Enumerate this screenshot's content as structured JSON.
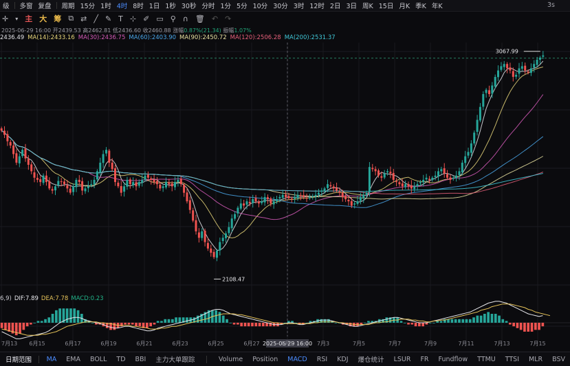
{
  "topbar": {
    "items": [
      "级",
      "多窗",
      "复盘",
      "周期",
      "15分",
      "1时",
      "4时",
      "8时",
      "1日",
      "1秒",
      "30秒",
      "分时",
      "1分",
      "5分",
      "10分",
      "30分",
      "3时",
      "12时",
      "2日",
      "3日",
      "周K",
      "15日",
      "月K",
      "季K",
      "年K"
    ],
    "active_index": 6,
    "right": "3s",
    "icons": [
      "grid-icon",
      "eye-icon",
      "chevron-down-icon"
    ]
  },
  "toolbar": {
    "crosshair": "✛",
    "zhu": "主",
    "da": "大",
    "chou": "筹",
    "tools": [
      "indicator-icon",
      "compare-icon",
      "line-icon",
      "draw-icon",
      "text-icon",
      "measure-icon",
      "brush-icon",
      "ruler-icon",
      "filter-icon",
      "magnet-icon",
      "delete-icon",
      "undo-icon",
      "redo-icon"
    ]
  },
  "info": {
    "date": "2025-06-29 16:00",
    "open_label": "开",
    "open": "2439.53",
    "high_label": "高",
    "high": "2462.81",
    "low_label": "低",
    "low": "2436.60",
    "close_label": "收",
    "close": "2460.88",
    "chg_label": "涨幅",
    "chg": "0.87%(21.34)",
    "amp_label": "振幅",
    "amp": "1.07%"
  },
  "ma_legend": [
    {
      "text": "2436.49",
      "color": "#e6e6ea"
    },
    {
      "text": "MA(14):2433.16",
      "color": "#e8d67a"
    },
    {
      "text": "MA(30):2436.75",
      "color": "#d55ab8"
    },
    {
      "text": "MA(60):2403.90",
      "color": "#4aa6e8"
    },
    {
      "text": "MA(90):2450.72",
      "color": "#e7e0a0"
    },
    {
      "text": "MA(120):2506.28",
      "color": "#e6607a"
    },
    {
      "text": "MA(200):2531.37",
      "color": "#40c8d8"
    }
  ],
  "macd_legend": [
    {
      "text": "6,9)",
      "color": "#c9c9cf"
    },
    {
      "text": "DIF:7.89",
      "color": "#e8e8ec"
    },
    {
      "text": "DEA:7.78",
      "color": "#e8c55a"
    },
    {
      "text": "MACD:0.23",
      "color": "#22b58a"
    }
  ],
  "chart_data": {
    "type": "candlestick",
    "symbol_price_unit": "USD",
    "ylim": [
      1990,
      3120
    ],
    "high_marker": "3067.99",
    "low_marker": "2108.47",
    "crosshair_label": "2025-06-29 16:00",
    "x_tick_labels": [
      "7月13",
      "6月15",
      "6月17",
      "6月19",
      "6月21",
      "6月23",
      "6月25",
      "6月27",
      "7月1",
      "7月3",
      "7月5",
      "7月7",
      "7月9",
      "7月11",
      "7月13",
      "7月15"
    ],
    "close": [
      2710,
      2690,
      2660,
      2640,
      2600,
      2560,
      2590,
      2620,
      2580,
      2550,
      2520,
      2490,
      2480,
      2470,
      2500,
      2470,
      2440,
      2430,
      2450,
      2475,
      2470,
      2460,
      2440,
      2420,
      2450,
      2480,
      2470,
      2430,
      2440,
      2450,
      2460,
      2480,
      2520,
      2560,
      2600,
      2620,
      2560,
      2530,
      2470,
      2450,
      2420,
      2450,
      2480,
      2460,
      2470,
      2450,
      2470,
      2480,
      2500,
      2490,
      2480,
      2470,
      2460,
      2440,
      2450,
      2470,
      2460,
      2450,
      2470,
      2480,
      2460,
      2420,
      2380,
      2340,
      2290,
      2240,
      2210,
      2240,
      2190,
      2160,
      2140,
      2120,
      2150,
      2190,
      2210,
      2230,
      2260,
      2300,
      2320,
      2350,
      2370,
      2360,
      2380,
      2370,
      2390,
      2380,
      2370,
      2380,
      2400,
      2390,
      2370,
      2380,
      2390,
      2400,
      2410,
      2400,
      2395,
      2390,
      2400,
      2410,
      2405,
      2400,
      2395,
      2400,
      2405,
      2410,
      2420,
      2430,
      2440,
      2460,
      2450,
      2440,
      2430,
      2420,
      2400,
      2390,
      2380,
      2360,
      2370,
      2380,
      2400,
      2410,
      2420,
      2540,
      2530,
      2520,
      2500,
      2490,
      2510,
      2520,
      2510,
      2480,
      2470,
      2460,
      2450,
      2460,
      2450,
      2440,
      2450,
      2460,
      2470,
      2480,
      2490,
      2480,
      2490,
      2500,
      2520,
      2530,
      2510,
      2490,
      2480,
      2490,
      2500,
      2520,
      2560,
      2590,
      2610,
      2650,
      2700,
      2760,
      2820,
      2880,
      2900,
      2880,
      2920,
      2960,
      2990,
      3010,
      3020,
      3000,
      2990,
      2960,
      2970,
      3000,
      3010,
      2990,
      2980,
      3000,
      3020,
      3040,
      3050,
      3060
    ],
    "dif": [
      -10,
      -12,
      -14,
      -16,
      -18,
      -18,
      -17,
      -16,
      -15,
      -14,
      -13,
      -12,
      -11,
      -9,
      -6,
      -3,
      0,
      2,
      4,
      5,
      6,
      6,
      5,
      3,
      2,
      1,
      0,
      -1,
      -2,
      -4,
      -5,
      -6,
      -6,
      -5,
      -4,
      -4,
      -5,
      -6,
      -7,
      -8,
      -9,
      -9,
      -8,
      -6,
      -5,
      -4,
      -3,
      -2,
      -1,
      0,
      1,
      2,
      3,
      4,
      6,
      8,
      10,
      12,
      14,
      15,
      15,
      14,
      12,
      10,
      9,
      8,
      7,
      6,
      5,
      4,
      3,
      2,
      1,
      0,
      -1,
      -2,
      -2,
      -2,
      -1,
      0,
      0,
      -1,
      -2,
      -2,
      -1,
      0,
      1,
      2,
      3,
      3,
      3,
      2,
      1,
      0,
      -1,
      -2,
      -3,
      -4,
      -4,
      -3,
      -2,
      -1,
      0,
      1,
      2,
      3,
      4,
      5,
      6,
      6,
      5,
      4,
      3,
      2,
      1,
      0,
      0,
      0,
      1,
      2,
      3,
      4,
      5,
      6,
      7,
      8,
      9,
      10,
      11,
      12,
      14,
      16,
      18,
      20,
      22,
      23,
      24,
      24,
      23,
      22,
      20,
      18,
      16,
      14,
      12,
      10,
      9,
      8,
      7,
      8
    ],
    "dea": [
      -7,
      -8,
      -9,
      -10,
      -11,
      -12,
      -13,
      -14,
      -14,
      -14,
      -14,
      -13,
      -13,
      -12,
      -11,
      -10,
      -8,
      -6,
      -4,
      -3,
      -2,
      -1,
      0,
      1,
      1,
      1,
      1,
      0,
      0,
      -1,
      -1,
      -2,
      -3,
      -3,
      -3,
      -3,
      -4,
      -4,
      -5,
      -5,
      -6,
      -7,
      -7,
      -7,
      -6,
      -6,
      -5,
      -4,
      -4,
      -3,
      -2,
      -1,
      0,
      1,
      2,
      3,
      4,
      5,
      7,
      8,
      9,
      10,
      10,
      10,
      10,
      9,
      9,
      8,
      7,
      6,
      5,
      4,
      3,
      2,
      1,
      0,
      0,
      -1,
      -1,
      -1,
      -1,
      -1,
      -1,
      -1,
      -1,
      -1,
      0,
      0,
      1,
      1,
      1,
      1,
      1,
      0,
      0,
      -1,
      -1,
      -2,
      -2,
      -2,
      -2,
      -2,
      -1,
      0,
      0,
      1,
      1,
      2,
      3,
      3,
      4,
      4,
      4,
      3,
      3,
      2,
      2,
      1,
      1,
      2,
      2,
      3,
      3,
      4,
      5,
      6,
      7,
      8,
      9,
      10,
      11,
      12,
      14,
      15,
      16,
      18,
      19,
      20,
      21,
      21,
      21,
      20,
      19,
      18,
      17,
      15,
      14,
      12,
      11,
      10,
      9,
      8
    ]
  },
  "bottombar": {
    "first": "日期范围",
    "items": [
      "MA",
      "EMA",
      "BOLL",
      "TD",
      "BBI",
      "主力大单跟踪",
      "Volume",
      "Position",
      "MACD",
      "RSI",
      "KDJ",
      "爆仓统计",
      "LSUR",
      "FR",
      "Fundflow",
      "TTMU",
      "TTSI",
      "MLR",
      "BSV"
    ],
    "active_main": "MA",
    "active_sub": "MACD"
  }
}
